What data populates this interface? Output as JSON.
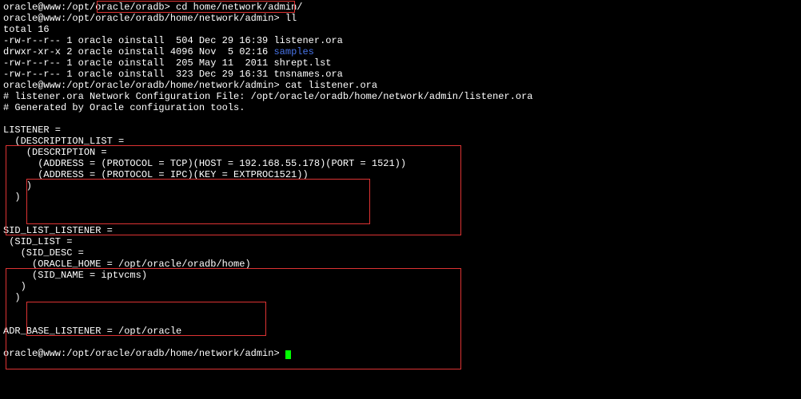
{
  "lines": {
    "l1_prompt": "oracle@www:/opt/oracle/oradb> ",
    "l1_cmd": "cd home/network/admin/",
    "l2_prompt": "oracle@www:/opt/oracle/oradb/home/network/admin> ",
    "l2_cmd": "ll",
    "l3": "total 16",
    "l4": "-rw-r--r-- 1 oracle oinstall  504 Dec 29 16:39 listener.ora",
    "l5a": "drwxr-xr-x 2 oracle oinstall 4096 Nov  5 02:16 ",
    "l5b": "samples",
    "l6": "-rw-r--r-- 1 oracle oinstall  205 May 11  2011 shrept.lst",
    "l7": "-rw-r--r-- 1 oracle oinstall  323 Dec 29 16:31 tnsnames.ora",
    "l8_prompt": "oracle@www:/opt/oracle/oradb/home/network/admin> ",
    "l8_cmd": "cat listener.ora",
    "l9": "# listener.ora Network Configuration File: /opt/oracle/oradb/home/network/admin/listener.ora",
    "l10": "# Generated by Oracle configuration tools.",
    "l11": "",
    "l12": "LISTENER =",
    "l13": "  (DESCRIPTION_LIST =",
    "l14": "    (DESCRIPTION =",
    "l15": "      (ADDRESS = (PROTOCOL = TCP)(HOST = 192.168.55.178)(PORT = 1521))",
    "l16": "      (ADDRESS = (PROTOCOL = IPC)(KEY = EXTPROC1521))",
    "l17": "    )",
    "l18": "  )",
    "l19": "",
    "l20": "",
    "l21": "SID_LIST_LISTENER =",
    "l22": " (SID_LIST =",
    "l23": "   (SID_DESC =",
    "l24": "     (ORACLE_HOME = /opt/oracle/oradb/home)",
    "l25": "     (SID_NAME = iptvcms)",
    "l26": "   )",
    "l27": "  )",
    "l28": "",
    "l29": "",
    "l30": "ADR_BASE_LISTENER = /opt/oracle",
    "l31": "",
    "l32_prompt": "oracle@www:/opt/oracle/oradb/home/network/admin> "
  }
}
